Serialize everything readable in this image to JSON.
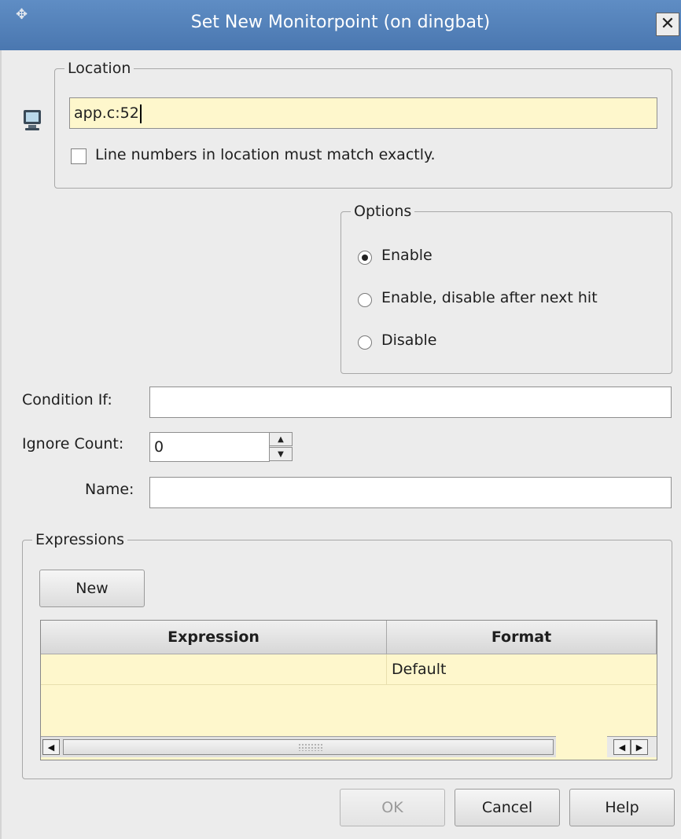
{
  "window": {
    "title": "Set New Monitorpoint (on dingbat)",
    "close_glyph": "✕"
  },
  "location": {
    "legend": "Location",
    "value": "app.c:52",
    "exact_match_label": "Line numbers in location must match exactly.",
    "exact_match_checked": false
  },
  "options": {
    "legend": "Options",
    "items": [
      {
        "label": "Enable",
        "selected": true
      },
      {
        "label": "Enable, disable after next hit",
        "selected": false
      },
      {
        "label": "Disable",
        "selected": false
      }
    ]
  },
  "condition": {
    "label": "Condition If:",
    "value": ""
  },
  "ignore_count": {
    "label": "Ignore Count:",
    "value": "0"
  },
  "name": {
    "label": "Name:",
    "value": ""
  },
  "expressions": {
    "legend": "Expressions",
    "new_label": "New",
    "columns": [
      "Expression",
      "Format"
    ],
    "rows": [
      {
        "expression": "",
        "format": "Default"
      }
    ]
  },
  "buttons": {
    "ok": "OK",
    "cancel": "Cancel",
    "help": "Help"
  },
  "colors": {
    "titlebar": "#5f8dc4",
    "highlight": "#fef7cc",
    "dialog_bg": "#ececec"
  },
  "icons": [
    "app-icon",
    "close-icon",
    "monitor-icon",
    "spin-up-icon",
    "spin-down-icon",
    "scroll-left-icon",
    "scroll-right-icon"
  ]
}
